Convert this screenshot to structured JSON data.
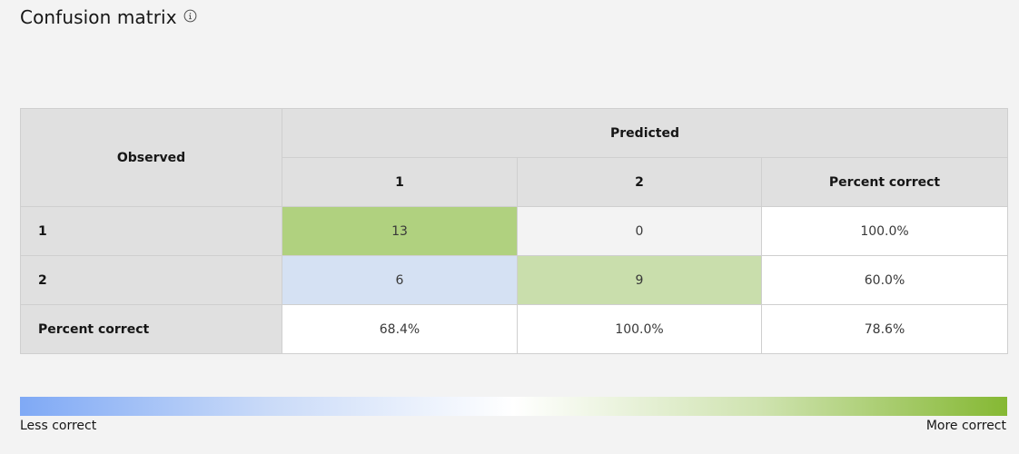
{
  "title": "Confusion matrix",
  "chart_data": {
    "type": "heatmap",
    "observed_header": "Observed",
    "predicted_header": "Predicted",
    "columns": [
      "1",
      "2",
      "Percent correct"
    ],
    "rows": [
      {
        "label": "1",
        "cells": [
          "13",
          "0",
          "100.0%"
        ],
        "colors": [
          "#b0d17f",
          "#f3f3f3",
          "#ffffff"
        ]
      },
      {
        "label": "2",
        "cells": [
          "6",
          "9",
          "60.0%"
        ],
        "colors": [
          "#d5e1f3",
          "#c9deac",
          "#ffffff"
        ]
      },
      {
        "label": "Percent correct",
        "cells": [
          "68.4%",
          "100.0%",
          "78.6%"
        ],
        "colors": [
          "#ffffff",
          "#ffffff",
          "#ffffff"
        ]
      }
    ],
    "values": [
      [
        13,
        0
      ],
      [
        6,
        9
      ]
    ],
    "percent_correct_rows": [
      100.0,
      60.0
    ],
    "percent_correct_cols": [
      68.4,
      100.0
    ],
    "percent_correct_overall": 78.6
  },
  "legend": {
    "less_label": "Less correct",
    "more_label": "More correct",
    "gradient_colors": [
      "#7fa9f5",
      "#c9daf8",
      "#ffffff",
      "#cfe3b0",
      "#85b833"
    ]
  }
}
